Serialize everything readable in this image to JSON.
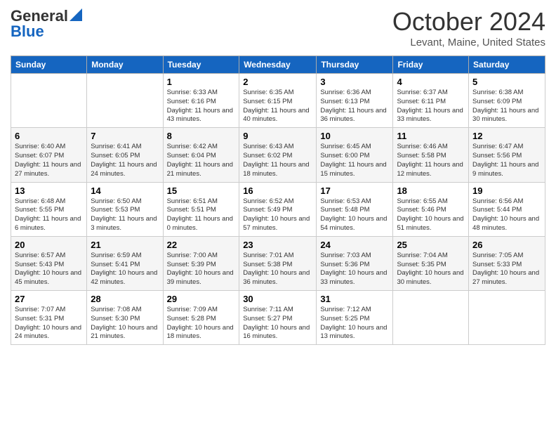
{
  "logo": {
    "general": "General",
    "blue": "Blue"
  },
  "header": {
    "month": "October 2024",
    "location": "Levant, Maine, United States"
  },
  "weekdays": [
    "Sunday",
    "Monday",
    "Tuesday",
    "Wednesday",
    "Thursday",
    "Friday",
    "Saturday"
  ],
  "weeks": [
    [
      {
        "day": "",
        "info": ""
      },
      {
        "day": "",
        "info": ""
      },
      {
        "day": "1",
        "info": "Sunrise: 6:33 AM\nSunset: 6:16 PM\nDaylight: 11 hours and 43 minutes."
      },
      {
        "day": "2",
        "info": "Sunrise: 6:35 AM\nSunset: 6:15 PM\nDaylight: 11 hours and 40 minutes."
      },
      {
        "day": "3",
        "info": "Sunrise: 6:36 AM\nSunset: 6:13 PM\nDaylight: 11 hours and 36 minutes."
      },
      {
        "day": "4",
        "info": "Sunrise: 6:37 AM\nSunset: 6:11 PM\nDaylight: 11 hours and 33 minutes."
      },
      {
        "day": "5",
        "info": "Sunrise: 6:38 AM\nSunset: 6:09 PM\nDaylight: 11 hours and 30 minutes."
      }
    ],
    [
      {
        "day": "6",
        "info": "Sunrise: 6:40 AM\nSunset: 6:07 PM\nDaylight: 11 hours and 27 minutes."
      },
      {
        "day": "7",
        "info": "Sunrise: 6:41 AM\nSunset: 6:05 PM\nDaylight: 11 hours and 24 minutes."
      },
      {
        "day": "8",
        "info": "Sunrise: 6:42 AM\nSunset: 6:04 PM\nDaylight: 11 hours and 21 minutes."
      },
      {
        "day": "9",
        "info": "Sunrise: 6:43 AM\nSunset: 6:02 PM\nDaylight: 11 hours and 18 minutes."
      },
      {
        "day": "10",
        "info": "Sunrise: 6:45 AM\nSunset: 6:00 PM\nDaylight: 11 hours and 15 minutes."
      },
      {
        "day": "11",
        "info": "Sunrise: 6:46 AM\nSunset: 5:58 PM\nDaylight: 11 hours and 12 minutes."
      },
      {
        "day": "12",
        "info": "Sunrise: 6:47 AM\nSunset: 5:56 PM\nDaylight: 11 hours and 9 minutes."
      }
    ],
    [
      {
        "day": "13",
        "info": "Sunrise: 6:48 AM\nSunset: 5:55 PM\nDaylight: 11 hours and 6 minutes."
      },
      {
        "day": "14",
        "info": "Sunrise: 6:50 AM\nSunset: 5:53 PM\nDaylight: 11 hours and 3 minutes."
      },
      {
        "day": "15",
        "info": "Sunrise: 6:51 AM\nSunset: 5:51 PM\nDaylight: 11 hours and 0 minutes."
      },
      {
        "day": "16",
        "info": "Sunrise: 6:52 AM\nSunset: 5:49 PM\nDaylight: 10 hours and 57 minutes."
      },
      {
        "day": "17",
        "info": "Sunrise: 6:53 AM\nSunset: 5:48 PM\nDaylight: 10 hours and 54 minutes."
      },
      {
        "day": "18",
        "info": "Sunrise: 6:55 AM\nSunset: 5:46 PM\nDaylight: 10 hours and 51 minutes."
      },
      {
        "day": "19",
        "info": "Sunrise: 6:56 AM\nSunset: 5:44 PM\nDaylight: 10 hours and 48 minutes."
      }
    ],
    [
      {
        "day": "20",
        "info": "Sunrise: 6:57 AM\nSunset: 5:43 PM\nDaylight: 10 hours and 45 minutes."
      },
      {
        "day": "21",
        "info": "Sunrise: 6:59 AM\nSunset: 5:41 PM\nDaylight: 10 hours and 42 minutes."
      },
      {
        "day": "22",
        "info": "Sunrise: 7:00 AM\nSunset: 5:39 PM\nDaylight: 10 hours and 39 minutes."
      },
      {
        "day": "23",
        "info": "Sunrise: 7:01 AM\nSunset: 5:38 PM\nDaylight: 10 hours and 36 minutes."
      },
      {
        "day": "24",
        "info": "Sunrise: 7:03 AM\nSunset: 5:36 PM\nDaylight: 10 hours and 33 minutes."
      },
      {
        "day": "25",
        "info": "Sunrise: 7:04 AM\nSunset: 5:35 PM\nDaylight: 10 hours and 30 minutes."
      },
      {
        "day": "26",
        "info": "Sunrise: 7:05 AM\nSunset: 5:33 PM\nDaylight: 10 hours and 27 minutes."
      }
    ],
    [
      {
        "day": "27",
        "info": "Sunrise: 7:07 AM\nSunset: 5:31 PM\nDaylight: 10 hours and 24 minutes."
      },
      {
        "day": "28",
        "info": "Sunrise: 7:08 AM\nSunset: 5:30 PM\nDaylight: 10 hours and 21 minutes."
      },
      {
        "day": "29",
        "info": "Sunrise: 7:09 AM\nSunset: 5:28 PM\nDaylight: 10 hours and 18 minutes."
      },
      {
        "day": "30",
        "info": "Sunrise: 7:11 AM\nSunset: 5:27 PM\nDaylight: 10 hours and 16 minutes."
      },
      {
        "day": "31",
        "info": "Sunrise: 7:12 AM\nSunset: 5:25 PM\nDaylight: 10 hours and 13 minutes."
      },
      {
        "day": "",
        "info": ""
      },
      {
        "day": "",
        "info": ""
      }
    ]
  ]
}
